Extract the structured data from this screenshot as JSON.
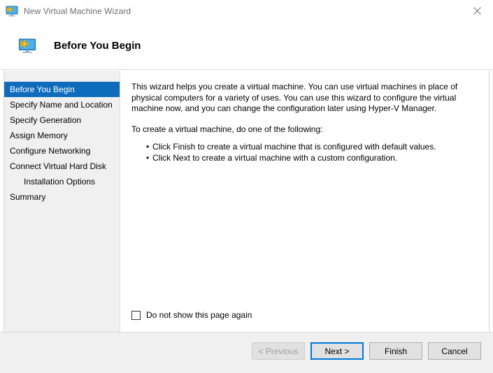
{
  "window": {
    "title": "New Virtual Machine Wizard",
    "title_icon": "virtual-machine-monitor-icon",
    "close_icon": "close-icon"
  },
  "header": {
    "icon": "virtual-machine-monitor-icon",
    "title": "Before You Begin"
  },
  "sidebar": {
    "items": [
      {
        "label": "Before You Begin",
        "selected": true,
        "indented": false
      },
      {
        "label": "Specify Name and Location",
        "selected": false,
        "indented": false
      },
      {
        "label": "Specify Generation",
        "selected": false,
        "indented": false
      },
      {
        "label": "Assign Memory",
        "selected": false,
        "indented": false
      },
      {
        "label": "Configure Networking",
        "selected": false,
        "indented": false
      },
      {
        "label": "Connect Virtual Hard Disk",
        "selected": false,
        "indented": false
      },
      {
        "label": "Installation Options",
        "selected": false,
        "indented": true
      },
      {
        "label": "Summary",
        "selected": false,
        "indented": false
      }
    ]
  },
  "content": {
    "intro_paragraph": "This wizard helps you create a virtual machine. You can use virtual machines in place of physical computers for a variety of uses. You can use this wizard to configure the virtual machine now, and you can change the configuration later using Hyper-V Manager.",
    "instruction_paragraph": "To create a virtual machine, do one of the following:",
    "bullets": [
      "Click Finish to create a virtual machine that is configured with default values.",
      "Click Next to create a virtual machine with a custom configuration."
    ],
    "checkbox": {
      "label": "Do not show this page again",
      "checked": false
    }
  },
  "footer": {
    "buttons": [
      {
        "label": "< Previous",
        "state": "disabled"
      },
      {
        "label": "Next >",
        "state": "focused"
      },
      {
        "label": "Finish",
        "state": "normal"
      },
      {
        "label": "Cancel",
        "state": "normal"
      }
    ]
  },
  "colors": {
    "selection_blue": "#0f6cbd",
    "focus_blue": "#0078d7",
    "panel_gray": "#f0f0f0",
    "button_face": "#e1e1e1",
    "title_text": "#6e6e6e"
  }
}
